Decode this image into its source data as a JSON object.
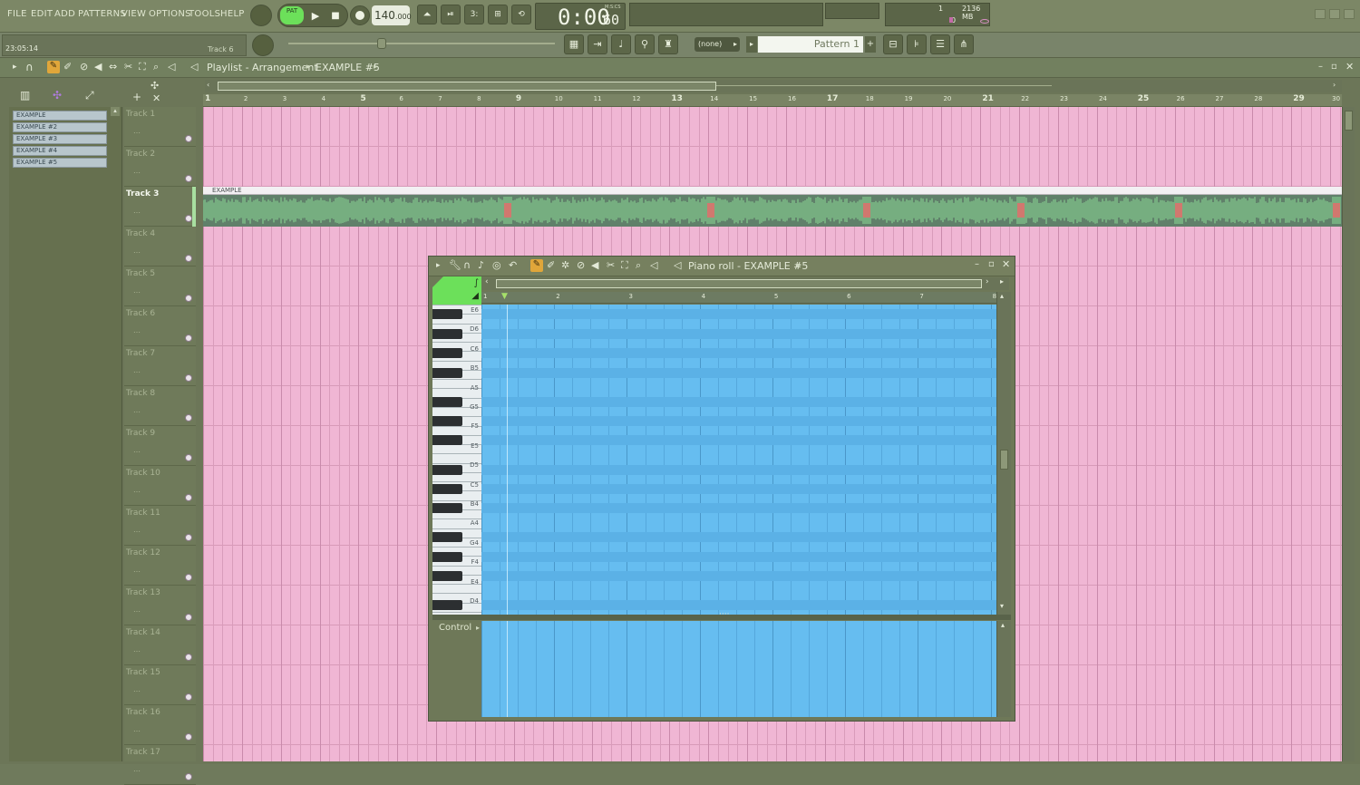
{
  "menu": [
    "FILE",
    "EDIT",
    "ADD",
    "PATTERNS",
    "VIEW",
    "OPTIONS",
    "TOOLS",
    "HELP"
  ],
  "transport": {
    "mode_label": "PAT",
    "tempo": "140",
    "tempo_decimal": ".000",
    "time": "0:00",
    "time_frac": "60",
    "time_format": "M:S:CS"
  },
  "monitor": {
    "cpu_value": "1",
    "memory": "2136 MB",
    "polyphony": "0"
  },
  "hint": {
    "clock": "23:05:14",
    "track_hint": "Track 6"
  },
  "channel_selector": "(none)",
  "pattern_selector": "Pattern 1",
  "playlist": {
    "title": "Playlist - Arrangement",
    "breadcrumb": "EXAMPLE #5",
    "picker_items": [
      "EXAMPLE",
      "EXAMPLE #2",
      "EXAMPLE #3",
      "EXAMPLE #4",
      "EXAMPLE #5"
    ],
    "clip_label": "EXAMPLE",
    "active_track": "Track 3",
    "tracks": [
      "Track 1",
      "Track 2",
      "Track 3",
      "Track 4",
      "Track 5",
      "Track 6",
      "Track 7",
      "Track 8",
      "Track 9",
      "Track 10",
      "Track 11",
      "Track 12",
      "Track 13",
      "Track 14",
      "Track 15",
      "Track 16",
      "Track 17"
    ],
    "ruler": [
      "1",
      "2",
      "3",
      "4",
      "5",
      "6",
      "7",
      "8",
      "9",
      "10",
      "11",
      "12",
      "13",
      "14",
      "15",
      "16",
      "17",
      "18",
      "19",
      "20",
      "21",
      "22",
      "23",
      "24",
      "25",
      "26",
      "27",
      "28",
      "29",
      "30"
    ]
  },
  "piano_roll": {
    "title": "Piano roll - EXAMPLE #5",
    "ruler": [
      "1",
      "2",
      "3",
      "4",
      "5",
      "6",
      "7",
      "8"
    ],
    "notes": [
      "E6",
      "D6",
      "C6",
      "B5",
      "A5",
      "G5",
      "F5",
      "E5",
      "D5",
      "C5",
      "B4",
      "A4",
      "G4",
      "F4",
      "E4",
      "D4"
    ],
    "control_label": "Control"
  },
  "colors": {
    "playlist_bg": "#f0b6d4",
    "piano_roll_bg": "#66bdf0",
    "clip_waveform": "#7fc28a",
    "pat_green": "#6ce05a"
  }
}
